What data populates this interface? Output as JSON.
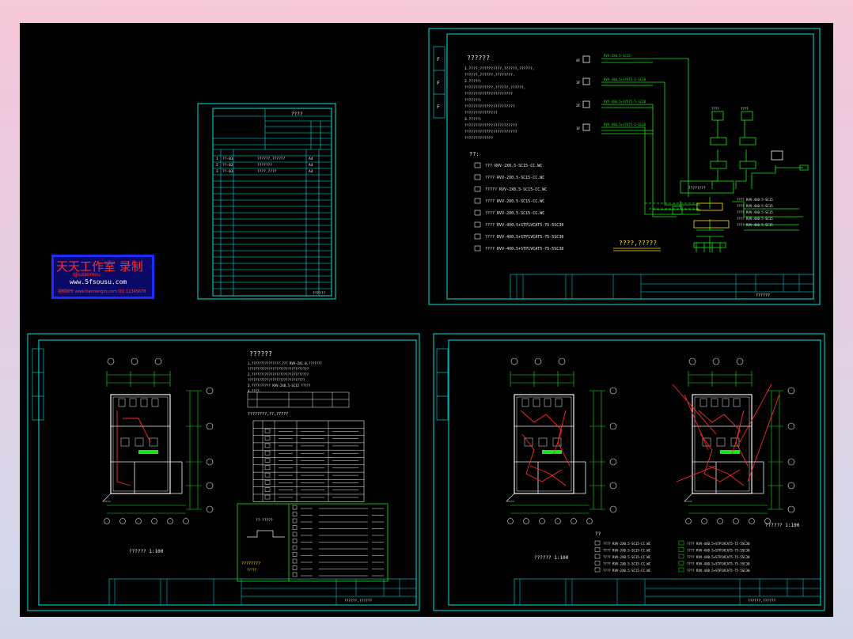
{
  "watermark": {
    "title": "天天工作室 录制",
    "subtitle": "qjiuzaomou",
    "url": "www.5fsousu.com",
    "footer": "视频制作 www.tiantiangzs.com  QQ:12345678"
  },
  "sheets": {
    "small": {
      "title": "????",
      "rows": [
        {
          "n": "1",
          "code": "??-01",
          "name": "??????,??????",
          "size": "A4"
        },
        {
          "n": "2",
          "code": "??-02",
          "name": "???????",
          "size": "A4"
        },
        {
          "n": "3",
          "code": "??-03",
          "name": "????,????",
          "size": "A4"
        }
      ],
      "stamp": "??????"
    },
    "system": {
      "heading": "??????",
      "notes": [
        "1.????,??????????,??????,??????,",
        "  ??????,??????,????????.",
        "2.?????:",
        "  ?????????????,??????,??????,",
        "  ??????????????????????",
        "  ???????:",
        "  ???????????????????????",
        "  ???????????????",
        "3.?????:",
        "  ????????????????????????",
        "  ????????????????????????",
        "  ?????????????"
      ],
      "legend_title": "??:",
      "legend": [
        "???   RVV-2X0.5-SC15-CC.WC",
        "????  RVV-2X0.5-SC15-CC.WC",
        "????? RVV-2X0.5-SC15-CC.WC",
        "????  RVV-2X0.5-SC15-CC.WC",
        "????  RVV-2X0.5-SC15-CC.WC",
        "????  RVV-4X0.5+STP1VCAT5-75-5SC30",
        "????  RVV-4X0.5+STP1VCAT5-75-5SC30",
        "????  RVV-4X0.5+STP1VCAT5-75-5SC30"
      ],
      "diagram_title": "????,?????",
      "cables": [
        "RVV-2X0.5-SC15",
        "RVV-4X0.5+SYV75-5-SC30",
        "RVV-4X0.5+SYV75-5-SC30",
        "RVV-4X0.5+SYV75-5-SC30"
      ],
      "right_labels": [
        "????  RVV-4X0.5-SC15",
        "????  RVV-4X0.5-SC15",
        "????  RVV-4X0.5-SC15",
        "????  RVV-4X0.5-SC15",
        "????  RVV-4X0.5-SC15"
      ],
      "title_block": "??????"
    },
    "plan1": {
      "heading": "??????",
      "notes": [
        "1.???????????????,??? RVV-2X1.0,???????",
        "  ????????????????????????????????",
        "2.??????????????????????????????",
        "  ??????????????????????????????",
        "3.?????????? RVV-2X0.5-SC15 ?????",
        "4.????:"
      ],
      "table_title": "????????,??,?????",
      "caption": "?????? 1:100",
      "legend_caption": "????????",
      "title_block": "??????,??????"
    },
    "plan2": {
      "caption1": "?????? 1:100",
      "caption2": "?????? 1:100",
      "legend_title": "??",
      "legend": [
        "????  RVV-2X0.5-SC15-CC.WC",
        "????  RVV-2X0.5-SC15-CC.WC",
        "????  RVV-2X0.5-SC15-CC.WC",
        "????  RVV-2X0.5-SC15-CC.WC",
        "????  RVV-2X0.5-SC15-CC.WC",
        "????  RVV-4X0.5+STP1VCAT5-75-5SC30",
        "????  RVV-4X0.5+STP1VCAT5-75-5SC30",
        "????  RVV-4X0.5+STP1VCAT5-75-5SC30",
        "????  RVV-4X0.5+STP1VCAT5-75-5SC30",
        "????  RVV-4X0.5+STP1VCAT5-75-5SC30"
      ],
      "title_block": "??????,??????"
    }
  },
  "colors": {
    "frame": "#00e5e5",
    "green": "#19e619",
    "red": "#ff2a2a",
    "white": "#f2f2f2",
    "yellow": "#ffe019"
  }
}
